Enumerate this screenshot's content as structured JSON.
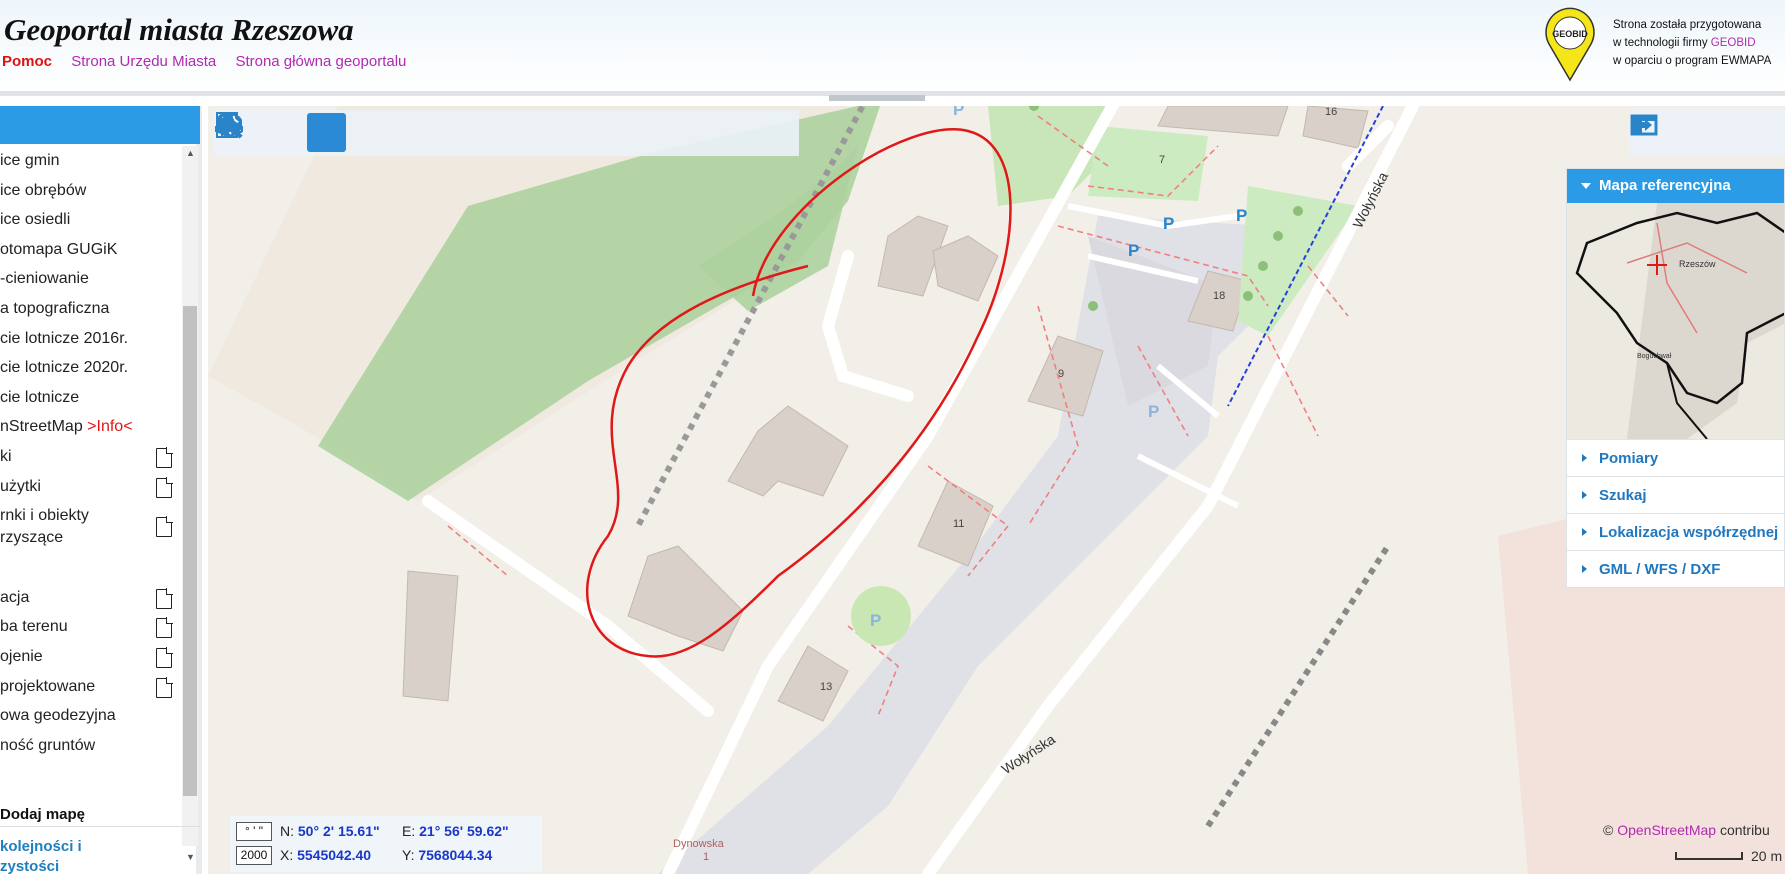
{
  "header": {
    "title": "Geoportal miasta Rzeszowa",
    "links": [
      "Pomoc",
      "Strona Urzędu Miasta",
      "Strona główna geoportalu"
    ],
    "logo_text": "GEOBID",
    "tech_line1": "Strona została przygotowana",
    "tech_line2_prefix": "w technologii firmy ",
    "tech_line2_brand": "GEOBID",
    "tech_line3": "w oparciu o program EWMAPA"
  },
  "left_panel": {
    "layers": [
      {
        "label": "ice gmin",
        "doc": false
      },
      {
        "label": "ice obrębów",
        "doc": false
      },
      {
        "label": "ice osiedli",
        "doc": false
      },
      {
        "label": "otomapa GUGiK",
        "doc": false
      },
      {
        "label": "-cieniowanie",
        "doc": false
      },
      {
        "label": "a topograficzna",
        "doc": false
      },
      {
        "label": "cie lotnicze 2016r.",
        "doc": false
      },
      {
        "label": "cie lotnicze 2020r.",
        "doc": false
      },
      {
        "label": "cie lotnicze",
        "doc": false
      },
      {
        "label": "nStreetMap ",
        "info": ">Info<",
        "doc": false
      },
      {
        "label": "ki",
        "doc": true
      },
      {
        "label": "użytki",
        "doc": true
      },
      {
        "label": "rnki i obiekty",
        "label2": "rzyszące",
        "doc": true
      },
      {
        "label": "",
        "doc": false
      },
      {
        "label": "acja",
        "doc": true
      },
      {
        "label": "ba terenu",
        "doc": true
      },
      {
        "label": "ojenie",
        "doc": true
      },
      {
        "label": "projektowane",
        "doc": true
      },
      {
        "label": "owa geodezyjna",
        "doc": false
      },
      {
        "label": "ność gruntów",
        "doc": false
      }
    ],
    "add_map": "Dodaj mapę",
    "order_line1": "kolejności i",
    "order_line2": "zystości"
  },
  "toolbar": {
    "tools": [
      "zoom-in-icon",
      "zoom-out-icon",
      "pan-hand-icon",
      "zoom-area-icon",
      "back-arrow-icon",
      "forward-arrow-icon",
      "link-icon",
      "info-icon",
      "info-edit-icon",
      "ruler-icon",
      "printer-icon",
      "globe-icon",
      "video-camera-icon"
    ],
    "active": "pan-hand-icon"
  },
  "right_panel": {
    "ref_title": "Mapa referencyjna",
    "ref_city": "Rzeszów",
    "ref_place": "Boguchwał",
    "accordion": [
      "Pomiary",
      "Szukaj",
      "Lokalizacja współrzędnej",
      "GML / WFS / DXF"
    ]
  },
  "map": {
    "street": "Wołyńska",
    "street2": "Dynowska",
    "street2_num": "1",
    "buildings": [
      "16",
      "7",
      "18",
      "9",
      "11",
      "13"
    ],
    "parking": "P"
  },
  "coords": {
    "fmt_dms": "° ' \"",
    "fmt_2000": "2000",
    "n_label": "N:",
    "n_value": "50° 2' 15.61\"",
    "e_label": "E:",
    "e_value": "21° 56' 59.62\"",
    "x_label": "X:",
    "x_value": "5545042.40",
    "y_label": "Y:",
    "y_value": "7568044.34"
  },
  "attribution": {
    "prefix": "© ",
    "osm": "OpenStreetMap",
    "suffix": " contribu",
    "scale": "20 m"
  },
  "colors": {
    "accent": "#2b9be6",
    "link": "#b02bb0",
    "help": "#d11111",
    "coord_value": "#1a38c8",
    "annotation": "#e01818"
  }
}
